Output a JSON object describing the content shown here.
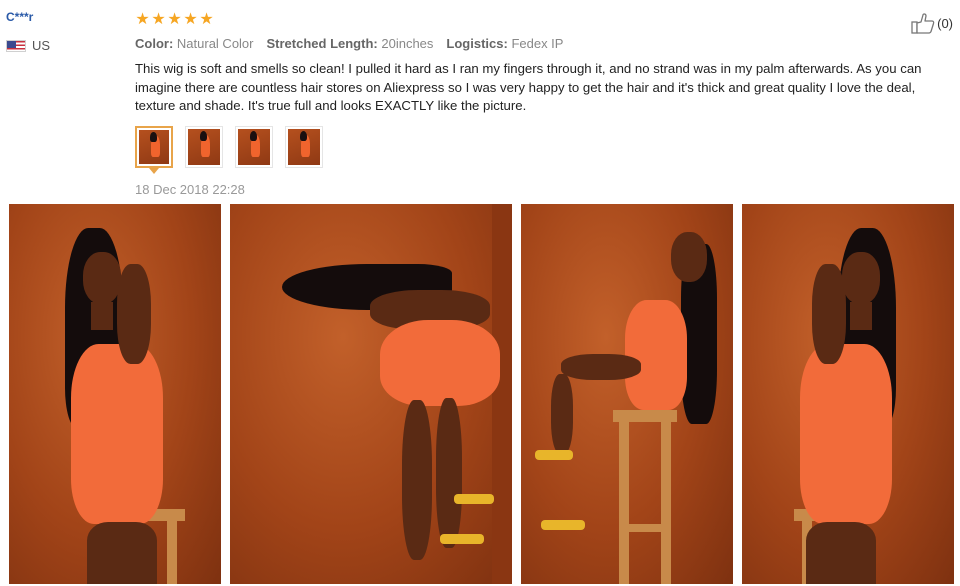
{
  "reviewer": {
    "name": "C***r",
    "country_code": "US",
    "flag_icon": "us-flag-icon"
  },
  "review": {
    "rating": 5,
    "star_color": "#f6a623",
    "attributes": [
      {
        "key": "Color:",
        "value": "Natural Color"
      },
      {
        "key": "Stretched Length:",
        "value": "20inches"
      },
      {
        "key": "Logistics:",
        "value": "Fedex IP"
      }
    ],
    "text": "This wig is soft and smells so clean! I pulled it hard as I ran my fingers through it, and no strand was in my palm afterwards. As you can imagine there are countless hair stores on Aliexpress so I was very happy to get the hair and it's thick and great quality I love the deal, texture and shade. It's true full and looks EXACTLY like the picture.",
    "date": "18 Dec 2018 22:28",
    "thumbnail_count": 4,
    "active_thumbnail": 0
  },
  "helpful": {
    "icon": "thumbs-up-icon",
    "count_label": "(0)"
  },
  "gallery": {
    "photo_count": 4,
    "accent_colors": {
      "background": "#a9481c",
      "dress": "#f26b3a",
      "hair": "#140c0c"
    }
  }
}
